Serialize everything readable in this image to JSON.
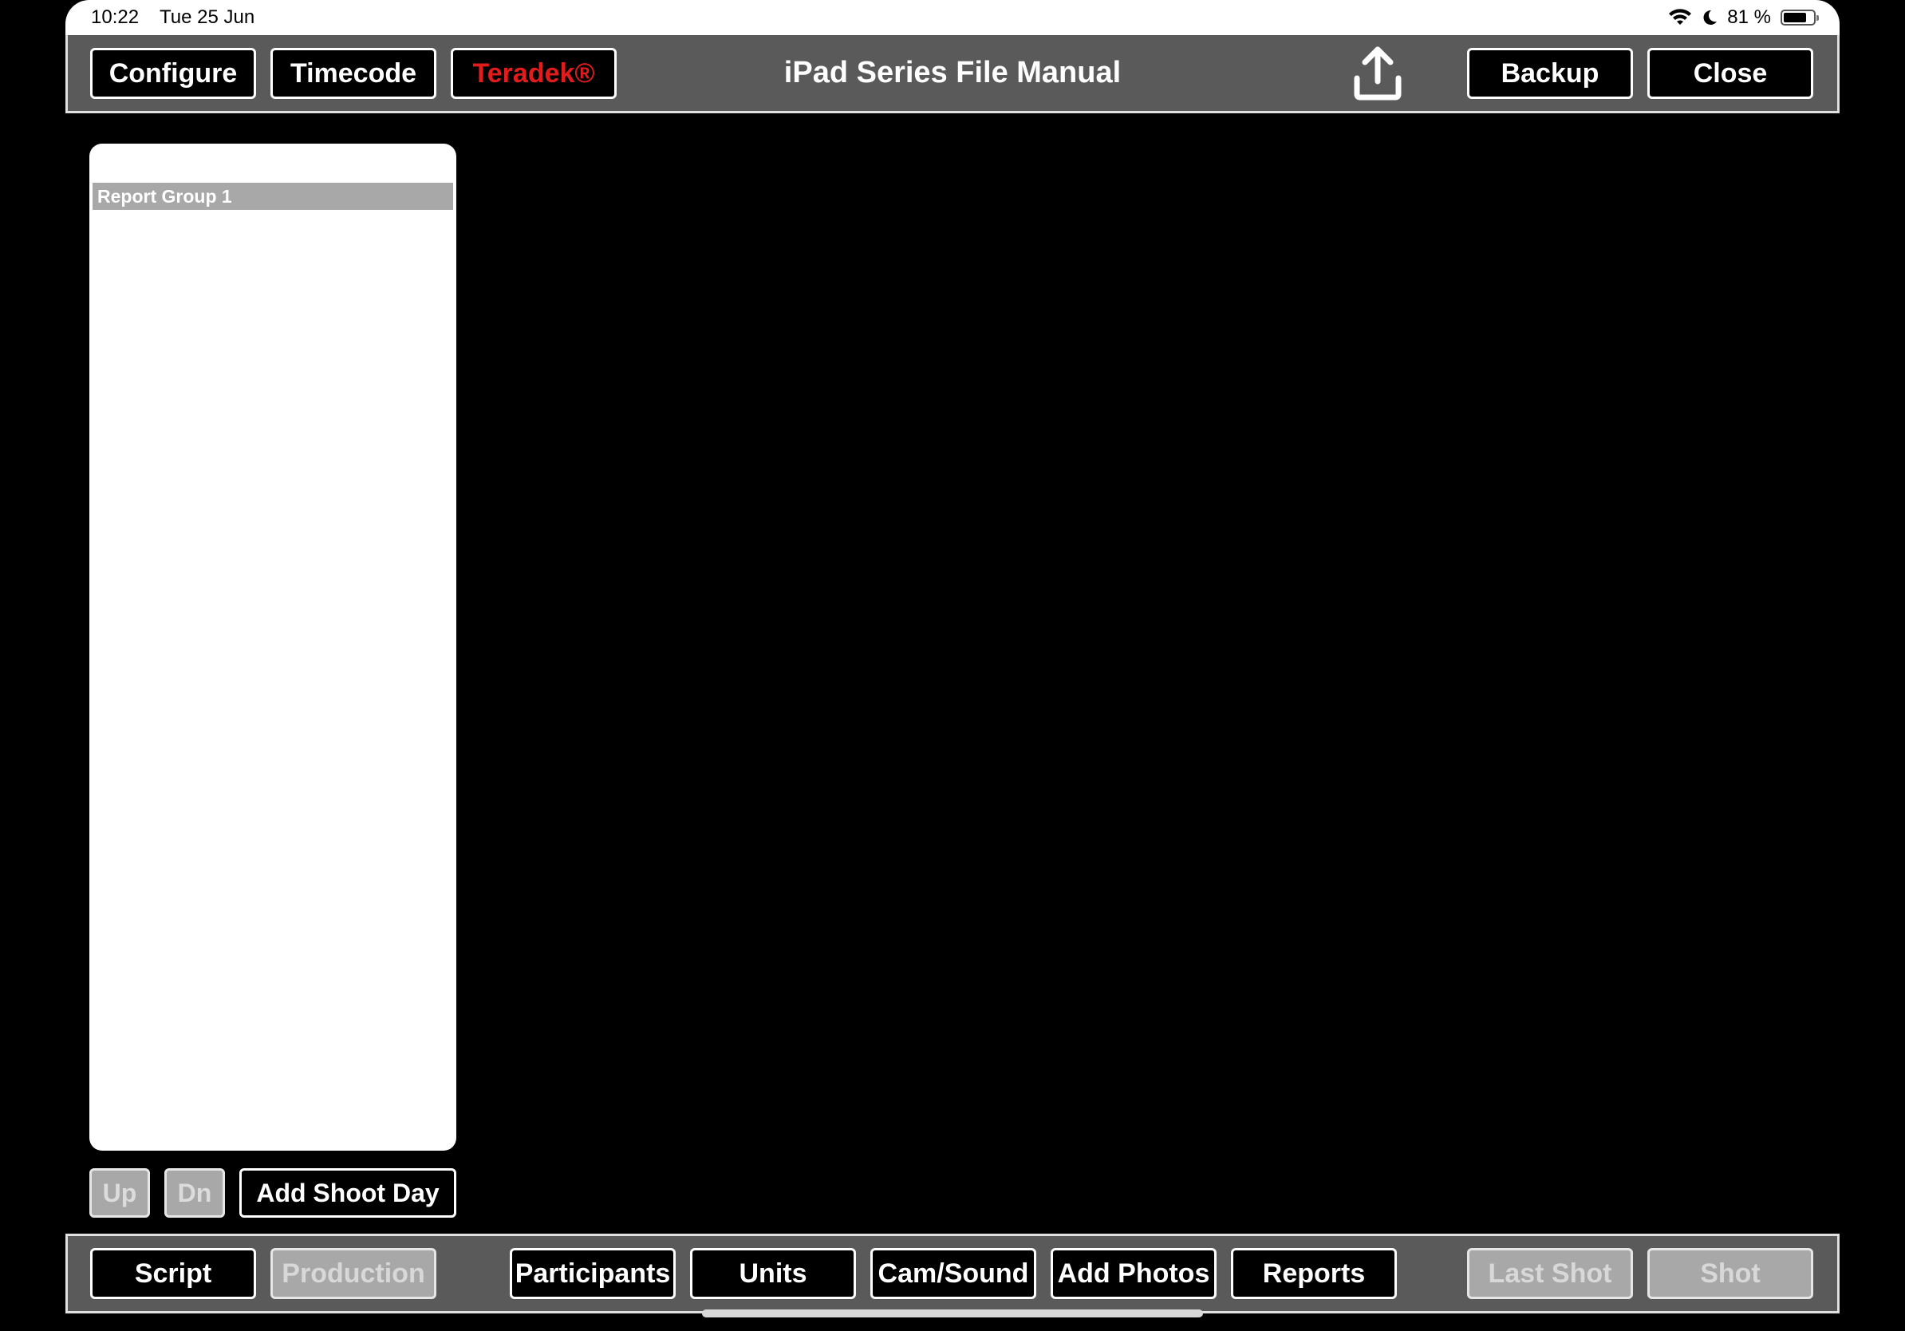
{
  "status": {
    "time": "10:22",
    "date": "Tue 25 Jun",
    "battery_percent": "81 %",
    "battery_level": 0.81
  },
  "header": {
    "title": "iPad Series File Manual",
    "configure": "Configure",
    "timecode": "Timecode",
    "teradek": "Teradek®",
    "backup": "Backup",
    "close": "Close",
    "share_icon": "share-upload-icon"
  },
  "list": {
    "items": [
      {
        "label": "Report Group 1"
      }
    ]
  },
  "list_controls": {
    "up": "Up",
    "dn": "Dn",
    "add_shoot_day": "Add Shoot Day"
  },
  "footer": {
    "script": "Script",
    "production": "Production",
    "participants": "Participants",
    "units": "Units",
    "cam_sound": "Cam/Sound",
    "add_photos": "Add Photos",
    "reports": "Reports",
    "last_shot": "Last Shot",
    "shot": "Shot"
  },
  "colors": {
    "toolbar_bg": "#5a5a5a",
    "button_bg": "#000000",
    "disabled_bg": "#a8a8a8",
    "teradek_text": "#e21c1c"
  }
}
